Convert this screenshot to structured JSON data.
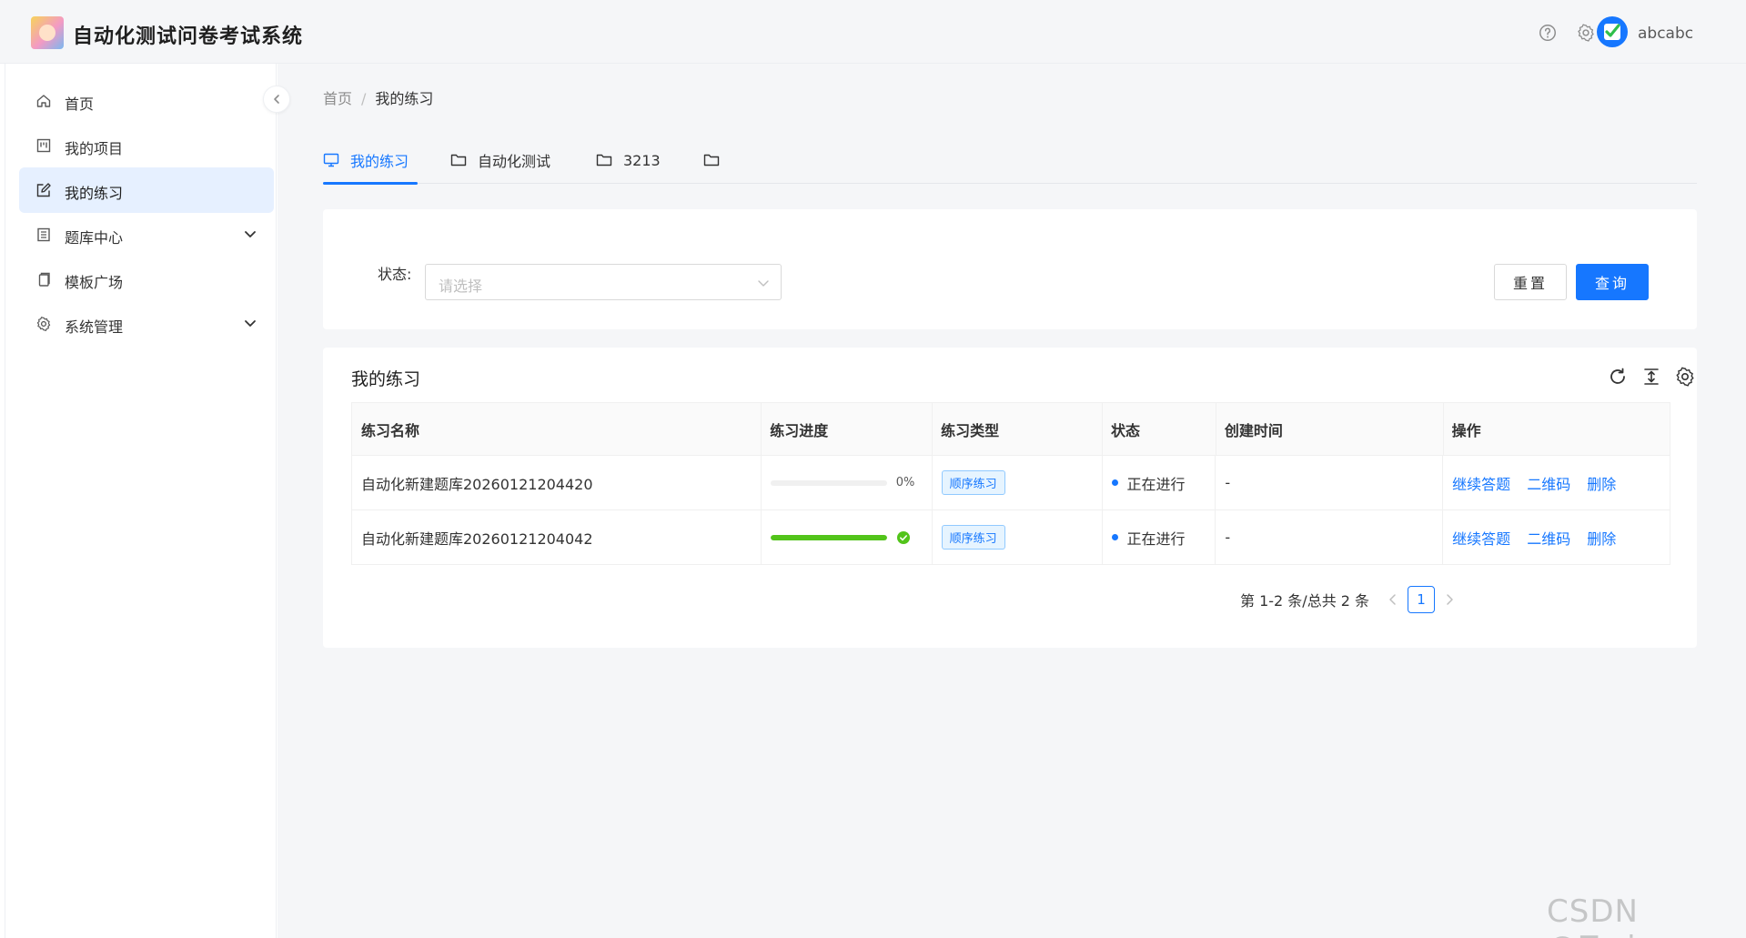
{
  "app": {
    "title": "自动化测试问卷考试系统"
  },
  "header": {
    "user_name": "abcabc"
  },
  "sidebar": {
    "items": [
      {
        "label": "首页",
        "icon": "home-icon"
      },
      {
        "label": "我的项目",
        "icon": "project-icon"
      },
      {
        "label": "我的练习",
        "icon": "edit-icon"
      },
      {
        "label": "题库中心",
        "icon": "book-icon"
      },
      {
        "label": "模板广场",
        "icon": "copy-icon"
      },
      {
        "label": "系统管理",
        "icon": "gear-icon"
      }
    ]
  },
  "breadcrumb": {
    "home": "首页",
    "sep": "/",
    "current": "我的练习"
  },
  "tabs": [
    {
      "label": "我的练习"
    },
    {
      "label": "自动化测试"
    },
    {
      "label": "3213"
    },
    {
      "label": ""
    }
  ],
  "filter": {
    "status_label": "状态:",
    "status_placeholder": "请选择",
    "reset_label": "重置",
    "query_label": "查询"
  },
  "table": {
    "title": "我的练习",
    "columns": [
      "练习名称",
      "练习进度",
      "练习类型",
      "状态",
      "创建时间",
      "操作"
    ],
    "rows": [
      {
        "name": "自动化新建题库20260121204420",
        "progress": 0,
        "progress_text": "0%",
        "type": "顺序练习",
        "status": "正在进行",
        "created": "-",
        "actions": [
          "继续答题",
          "二维码",
          "删除"
        ]
      },
      {
        "name": "自动化新建题库20260121204042",
        "progress": 100,
        "progress_text": "",
        "type": "顺序练习",
        "status": "正在进行",
        "created": "-",
        "actions": [
          "继续答题",
          "二维码",
          "删除"
        ]
      }
    ]
  },
  "pagination": {
    "summary": "第 1-2 条/总共 2 条",
    "current_page": "1"
  },
  "watermark": "CSDN @Zwj-c",
  "colors": {
    "primary": "#1677ff",
    "success": "#52c41a",
    "active_menu_bg": "#e6f0ff"
  }
}
